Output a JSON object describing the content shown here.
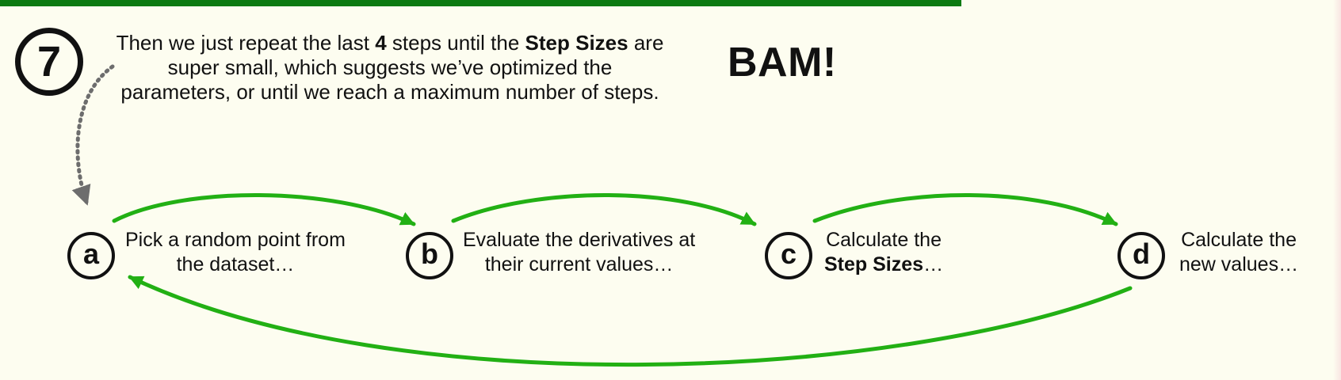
{
  "step": {
    "number": "7",
    "line1_a": "Then we just repeat the last ",
    "line1_b": "4",
    "line1_c": " steps until the ",
    "line1_d": "Step Sizes",
    "line1_e": " are",
    "line2": "super small, which suggests we’ve optimized the",
    "line3": "parameters, or until we reach a maximum number of steps."
  },
  "exclamation": "BAM!",
  "cycle": [
    {
      "letter": "a",
      "line1": "Pick a random point from",
      "line2": "the dataset…"
    },
    {
      "letter": "b",
      "line1": "Evaluate the derivatives at",
      "line2": "their current values…"
    },
    {
      "letter": "c",
      "line1": "Calculate the",
      "line2_bold": "Step Sizes",
      "line2_rest": "…"
    },
    {
      "letter": "d",
      "line1": "Calculate the",
      "line2": "new values…"
    }
  ],
  "colors": {
    "header_bar": "#0c7a12",
    "arrow_green": "#22b014",
    "dotted_arrow": "#6d6d6d",
    "background": "#fdfdf0"
  }
}
